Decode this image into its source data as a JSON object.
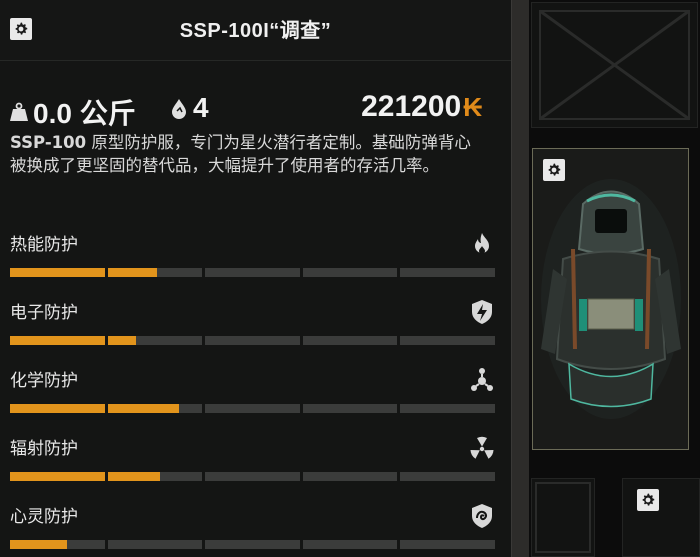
{
  "item": {
    "title": "SSP-100I“调查”",
    "weight": "0.0 公斤",
    "durability": "4",
    "price": "221200",
    "currency": "₭",
    "description_code": "SSP-100",
    "description_text": " 原型防护服，专门为星火潜行者定制。基础防弹背心被换成了更坚固的替代品，大幅提升了使用者的存活几率。"
  },
  "protections": [
    {
      "label": "热能防护",
      "icon": "flame-icon",
      "level": 0.305
    },
    {
      "label": "电子防护",
      "icon": "electric-shield-icon",
      "level": 0.26
    },
    {
      "label": "化学防护",
      "icon": "chemical-icon",
      "level": 0.35
    },
    {
      "label": "辐射防护",
      "icon": "radiation-icon",
      "level": 0.31
    },
    {
      "label": "心灵防护",
      "icon": "psy-shield-icon",
      "level": 0.12
    }
  ],
  "colors": {
    "accent": "#e2941c",
    "bar_empty": "#3b3c3b",
    "currency": "#e08a1a"
  },
  "icons": {
    "settings": "gear-icon",
    "weight": "weight-icon",
    "durability": "drop-icon"
  }
}
